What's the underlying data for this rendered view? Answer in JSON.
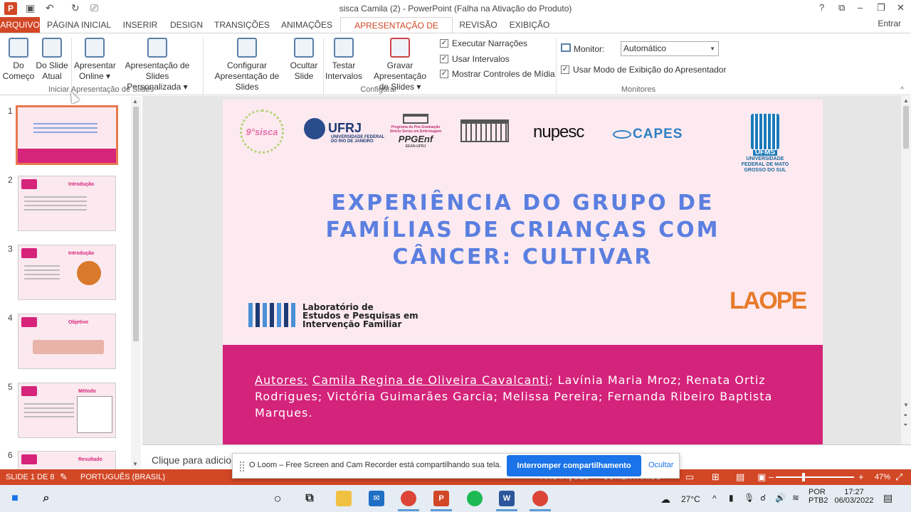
{
  "window": {
    "title": "sisca Camila (2) - PowerPoint (Falha na Ativação do Produto)",
    "app_logo": "P",
    "signin": "Entrar",
    "controls": [
      "?",
      "⧉",
      "–",
      "❐",
      "✕"
    ]
  },
  "quick_access": [
    "save-icon",
    "undo-icon",
    "redo-icon",
    "present-icon"
  ],
  "tabs": [
    {
      "label": "ARQUIVO"
    },
    {
      "label": "PÁGINA INICIAL"
    },
    {
      "label": "INSERIR"
    },
    {
      "label": "DESIGN"
    },
    {
      "label": "TRANSIÇÕES"
    },
    {
      "label": "ANIMAÇÕES"
    },
    {
      "label": "APRESENTAÇÃO DE SLIDES"
    },
    {
      "label": "REVISÃO"
    },
    {
      "label": "EXIBIÇÃO"
    }
  ],
  "ribbon": {
    "groups": {
      "start": "Iniciar Apresentação de Slides",
      "setup": "Configurar",
      "monitors": "Monitores"
    },
    "buttons": {
      "from_beginning": [
        "Do",
        "Começo"
      ],
      "from_current": [
        "Do Slide",
        "Atual"
      ],
      "present_online": [
        "Apresentar",
        "Online ▾"
      ],
      "custom_show": [
        "Apresentação de Slides",
        "Personalizada ▾"
      ],
      "setup_show": [
        "Configurar",
        "Apresentação de Slides"
      ],
      "hide_slide": [
        "Ocultar",
        "Slide"
      ],
      "rehearse": [
        "Testar",
        "Intervalos"
      ],
      "record": [
        "Gravar Apresentação",
        "de Slides ▾"
      ]
    },
    "checkboxes": {
      "play_narrations": "Executar Narrações",
      "use_timings": "Usar Intervalos",
      "show_media_controls": "Mostrar Controles de Mídia",
      "presenter_view": "Usar Modo de Exibição do Apresentador"
    },
    "monitor_label": "Monitor:",
    "monitor_value": "Automático"
  },
  "thumbnails": [
    {
      "num": "1",
      "heading": ""
    },
    {
      "num": "2",
      "heading": "Introdução"
    },
    {
      "num": "3",
      "heading": "Introdução"
    },
    {
      "num": "4",
      "heading": "Objetivo"
    },
    {
      "num": "5",
      "heading": "Método"
    },
    {
      "num": "6",
      "heading": "Resultado"
    }
  ],
  "slide": {
    "logos": {
      "sisca": "9°sisca",
      "ufrj": "UFRJ",
      "ufrj_sub": "UNIVERSIDADE FEDERAL DO RIO DE JANEIRO",
      "ppgenf": "PPGEnf",
      "ppgenf_sub": "Programa de Pós-Graduação Stricto Sensu em Enfermagem",
      "ppgenf_foot": "EEAN-UFRJ",
      "nupesc": "nupesc",
      "capes": "CAPES",
      "ufms": "UFMS",
      "ufms_name": "UNIVERSIDADE FEDERAL DE MATO GROSSO DO SUL",
      "lab_line1": "Laboratório de",
      "lab_line2": "Estudos e Pesquisas em",
      "lab_line3": "Intervenção Familiar",
      "laope": "LAOPE"
    },
    "title_lines": [
      "EXPERIÊNCIA DO GRUPO DE",
      "FAMÍLIAS DE CRIANÇAS COM",
      "CÂNCER: CULTIVAR"
    ],
    "authors_label": "Autores:",
    "authors": [
      {
        "name": "Camila Regina de Oliveira Cavalcanti",
        "underline": true,
        "sep": "; "
      },
      {
        "name": "Lavínia Maria Mroz",
        "underline": false,
        "sep": "; "
      },
      {
        "name": "Renata Ortiz Rodrigues",
        "underline": false,
        "sep": "; "
      },
      {
        "name": "Victória Guimarães Garcia",
        "underline": false,
        "sep": "; "
      },
      {
        "name": "Melissa Pereira",
        "underline": false,
        "sep": "; "
      },
      {
        "name": "Fernanda Ribeiro Baptista Marques",
        "underline": false,
        "sep": "."
      }
    ]
  },
  "notes_placeholder": "Clique para adicior",
  "loom": {
    "message": "O Loom – Free Screen and Cam Recorder está compartilhando sua tela.",
    "stop_button": "Interromper compartilhamento",
    "hide_link": "Ocultar"
  },
  "statusbar": {
    "slide_counter": "SLIDE 1 DE 8",
    "language": "PORTUGUÊS (BRASIL)",
    "annotations": "ANOTAÇÕES",
    "comments": "COMENTÁRIOS",
    "zoom_minus": "–",
    "zoom_plus": "+",
    "zoom": "47%"
  },
  "taskbar": {
    "apps": [
      "Word",
      "PowerPoint",
      "Spotify",
      "Chrome",
      "Mail",
      "Explorer",
      "Task View",
      "Cortana"
    ],
    "temperature": "27°C",
    "lang_line1": "POR",
    "lang_line2": "PTB2",
    "time": "17:27",
    "date": "06/03/2022"
  },
  "colors": {
    "accent": "#d24726",
    "slide_bg": "#fdeaf0",
    "slide_bar": "#d4237a",
    "title_blue": "#5b7fe0",
    "loom_blue": "#1a73e8"
  }
}
